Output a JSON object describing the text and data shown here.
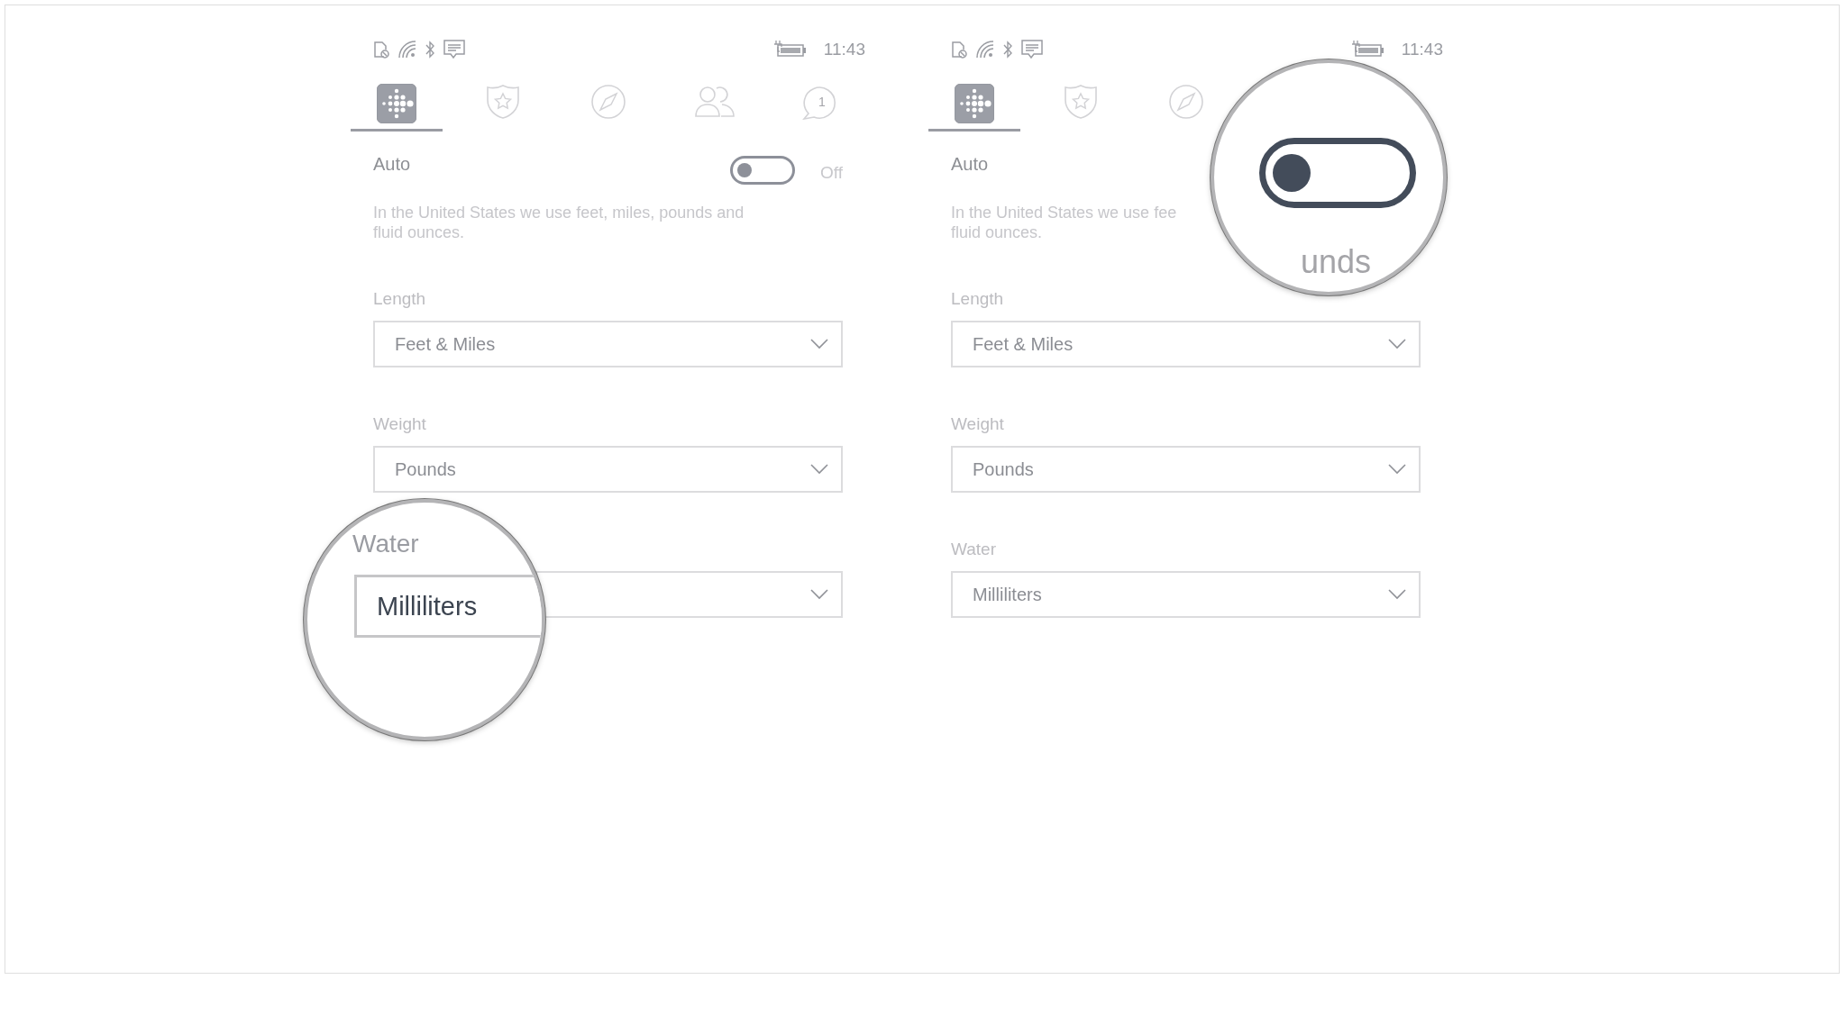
{
  "screens": [
    {
      "status_bar": {
        "time": "11:43"
      },
      "tabs": [
        {
          "kind": "fitbit",
          "selected": true
        },
        {
          "kind": "challenges",
          "selected": false
        },
        {
          "kind": "compass",
          "selected": false
        },
        {
          "kind": "friends",
          "selected": false
        },
        {
          "kind": "messages",
          "badge": "1",
          "selected": false
        }
      ],
      "auto": {
        "label": "Auto",
        "on": false,
        "state_text": "Off"
      },
      "description": [
        "In the United States we use feet, miles, pounds and",
        "fluid ounces."
      ],
      "settings": [
        {
          "label": "Length",
          "value": "Feet & Miles"
        },
        {
          "label": "Weight",
          "value": "Pounds"
        },
        {
          "kind": "magnified",
          "label": "Water",
          "value": "Milliliters"
        }
      ]
    },
    {
      "status_bar": {
        "time": "11:43"
      },
      "tabs": [
        {
          "kind": "fitbit",
          "selected": true
        },
        {
          "kind": "challenges",
          "selected": false
        },
        {
          "kind": "compass",
          "selected": false
        }
      ],
      "auto": {
        "label": "Auto"
      },
      "description": [
        "In the United States we use fee",
        "fluid ounces."
      ],
      "settings": [
        {
          "label": "Length",
          "value": "Feet & Miles"
        },
        {
          "label": "Weight",
          "value": "Pounds"
        },
        {
          "label": "Water",
          "value": "Milliliters"
        }
      ]
    }
  ],
  "magnifiers": [
    {
      "kind": "toggle",
      "on": false,
      "text": "unds"
    }
  ]
}
